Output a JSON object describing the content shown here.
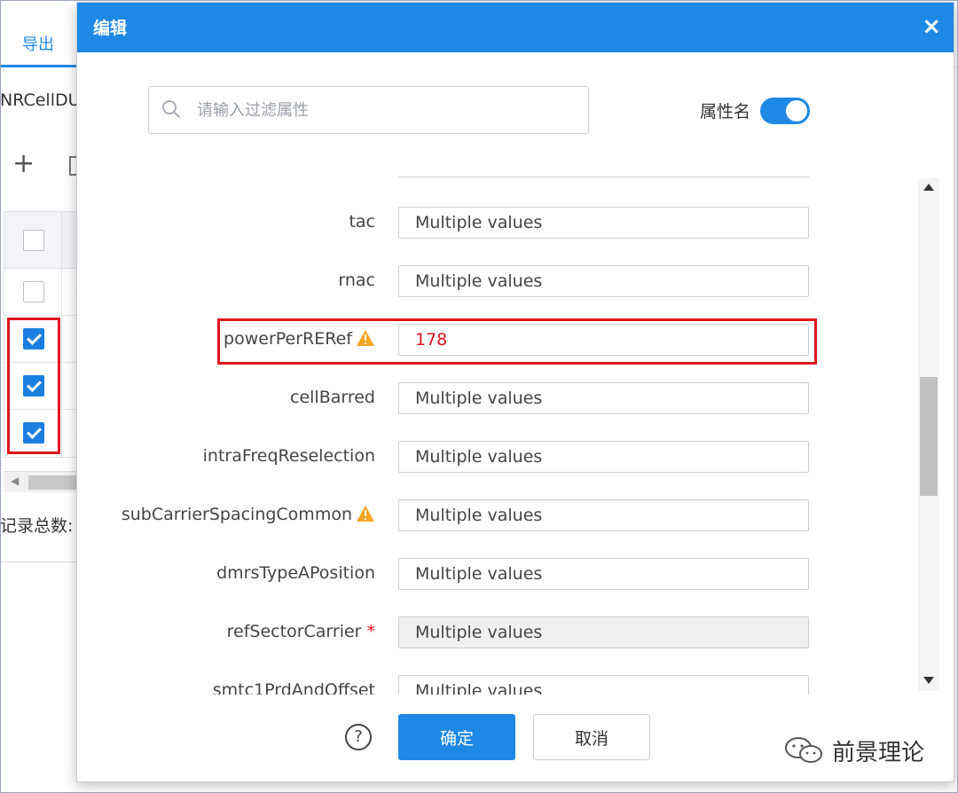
{
  "background": {
    "tab_export": "导出",
    "object_name": "NRCellDU",
    "total_label": "记录总数:",
    "rows": [
      {
        "checked": false
      },
      {
        "checked": true
      },
      {
        "checked": true
      },
      {
        "checked": true
      }
    ]
  },
  "dialog": {
    "title": "编辑",
    "close": "×",
    "filter_placeholder": "请输入过滤属性",
    "attr_name_label": "属性名",
    "attr_name_toggle_on": true,
    "fields": [
      {
        "label": "tac",
        "value": "Multiple values"
      },
      {
        "label": "rnac",
        "value": "Multiple values"
      },
      {
        "label": "powerPerRERef",
        "value": "178",
        "warning": true,
        "changed": true
      },
      {
        "label": "cellBarred",
        "value": "Multiple values"
      },
      {
        "label": "intraFreqReselection",
        "value": "Multiple values"
      },
      {
        "label": "subCarrierSpacingCommon",
        "value": "Multiple values",
        "warning": true
      },
      {
        "label": "dmrsTypeAPosition",
        "value": "Multiple values"
      },
      {
        "label": "refSectorCarrier",
        "value": "Multiple values",
        "required": true,
        "disabled": true
      },
      {
        "label": "smtc1PrdAndOffset",
        "value": "Multiple values"
      }
    ],
    "required_mark": "*",
    "help": "?",
    "ok_label": "确定",
    "cancel_label": "取消"
  },
  "watermark": {
    "text": "前景理论"
  },
  "colors": {
    "primary": "#1e88e5",
    "highlight_red": "#e0141e",
    "warning": "#f5a623"
  }
}
